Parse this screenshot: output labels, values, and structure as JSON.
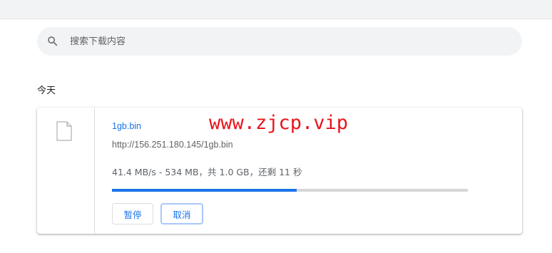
{
  "search": {
    "placeholder": "搜索下载内容",
    "icon": "search-icon"
  },
  "section": {
    "title": "今天"
  },
  "download": {
    "icon": "file-icon",
    "file_name": "1gb.bin",
    "url": "http://156.251.180.145/1gb.bin",
    "status": "41.4 MB/s - 534 MB，共 1.0 GB，还剩 11 秒",
    "progress_fraction": 0.52,
    "pause_label": "暂停",
    "cancel_label": "取消"
  },
  "watermark": {
    "text": "www.zjcp.vip"
  },
  "colors": {
    "accent": "#1a73e8",
    "progress_track": "#d7d7d7",
    "watermark": "#e8151c",
    "search_bg": "#f1f3f4"
  }
}
